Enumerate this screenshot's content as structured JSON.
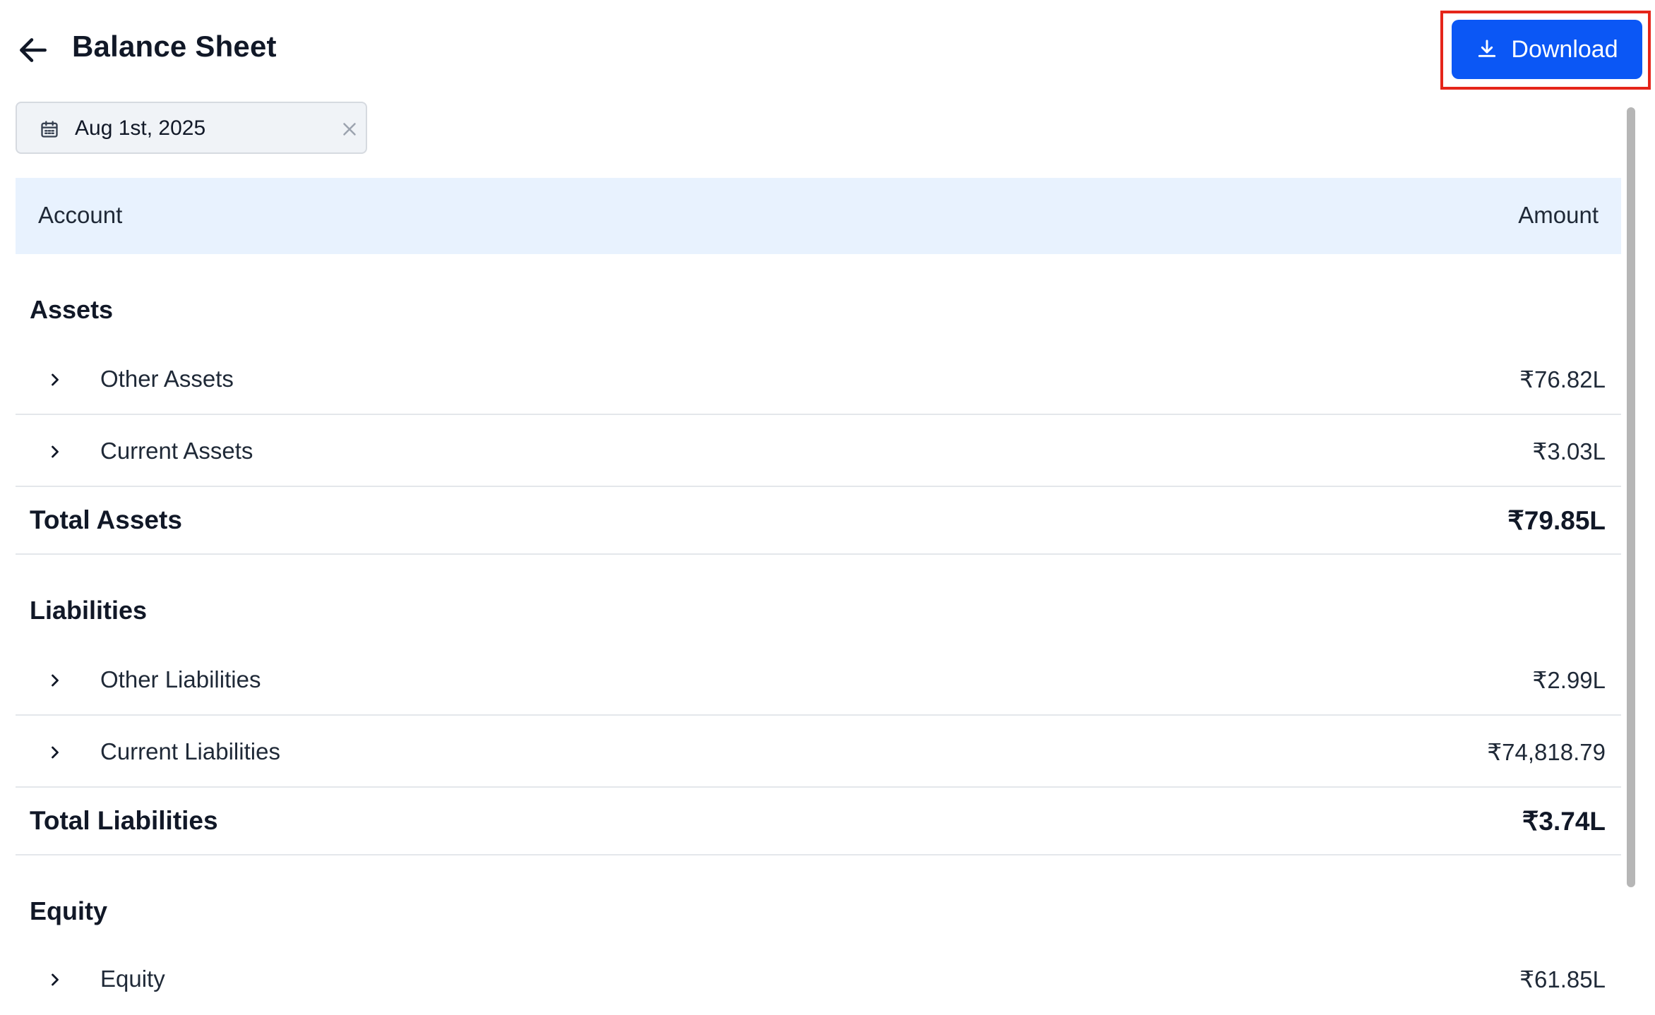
{
  "header": {
    "title": "Balance Sheet",
    "download_label": "Download"
  },
  "date_filter": {
    "value": "Aug 1st, 2025"
  },
  "table": {
    "col_account": "Account",
    "col_amount": "Amount"
  },
  "sections": {
    "assets": {
      "title": "Assets",
      "rows": [
        {
          "label": "Other Assets",
          "amount": "₹76.82L"
        },
        {
          "label": "Current Assets",
          "amount": "₹3.03L"
        }
      ],
      "total_label": "Total Assets",
      "total_amount": "₹79.85L"
    },
    "liabilities": {
      "title": "Liabilities",
      "rows": [
        {
          "label": "Other Liabilities",
          "amount": "₹2.99L"
        },
        {
          "label": "Current Liabilities",
          "amount": "₹74,818.79"
        }
      ],
      "total_label": "Total Liabilities",
      "total_amount": "₹3.74L"
    },
    "equity": {
      "title": "Equity",
      "rows": [
        {
          "label": "Equity",
          "amount": "₹61.85L"
        }
      ]
    }
  },
  "colors": {
    "primary": "#0b57f5",
    "highlight_outline": "#e5251a",
    "table_header_bg": "#e8f2fe"
  },
  "icons": {
    "back": "arrow-left-icon",
    "download": "download-icon",
    "calendar": "calendar-icon",
    "clear": "close-icon",
    "expand": "chevron-right-icon"
  }
}
